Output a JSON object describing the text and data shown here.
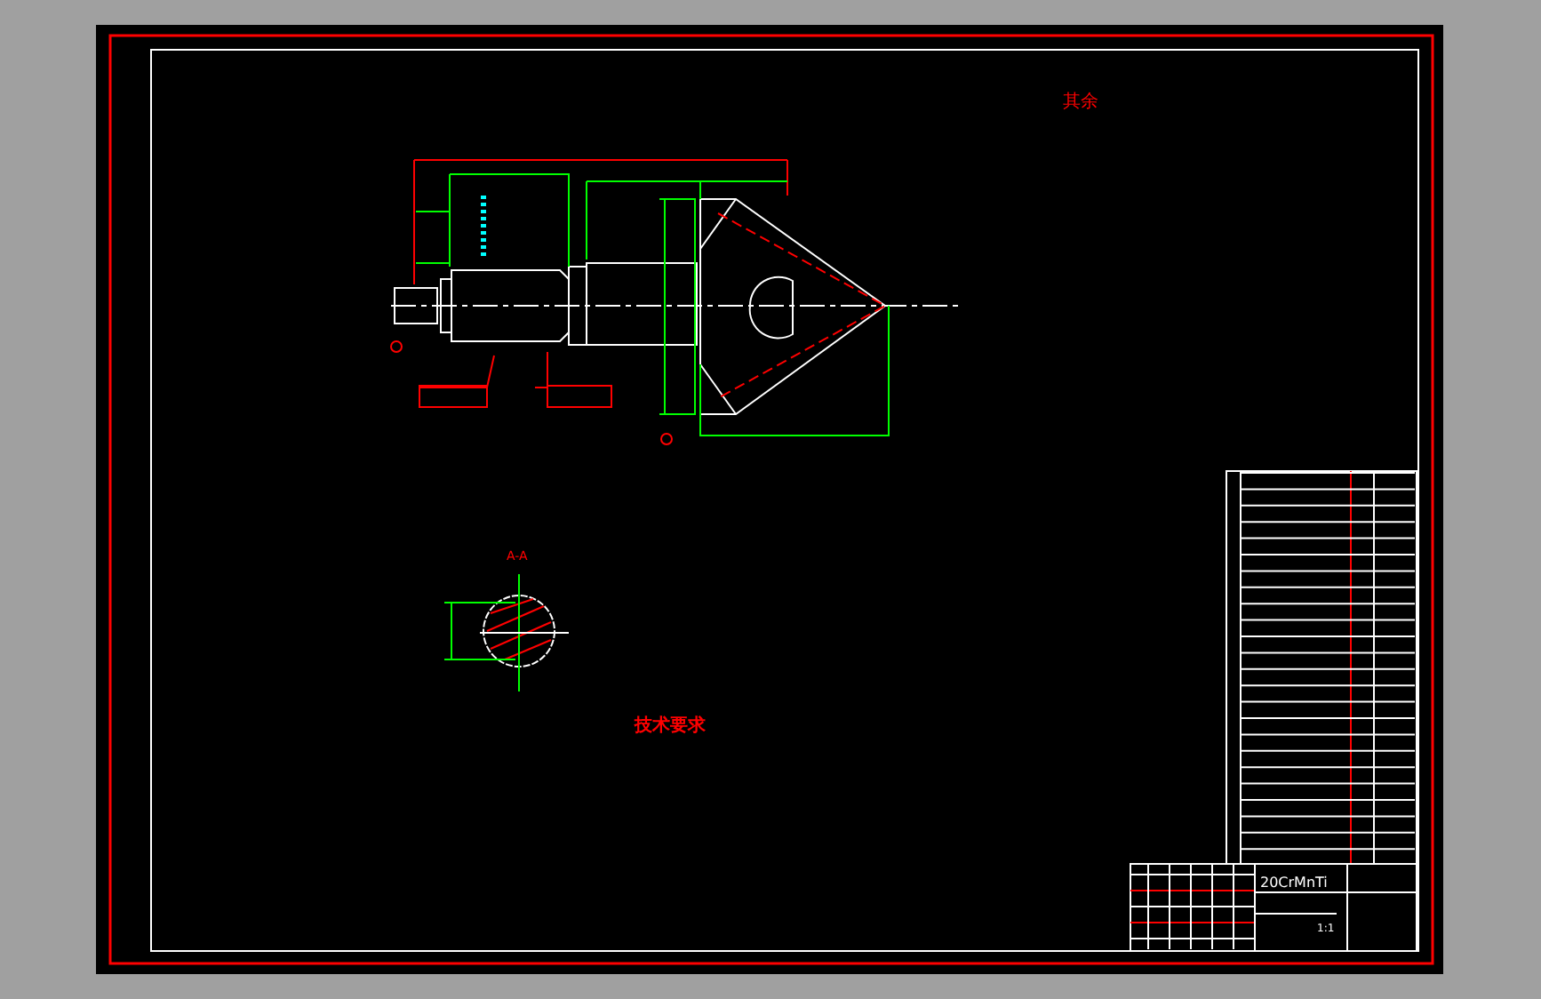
{
  "drawing": {
    "surface_note": "其余",
    "section_label": "A-A",
    "requirements_title": "技术要求",
    "material": "20CrMnTi",
    "scale": "1:1"
  }
}
